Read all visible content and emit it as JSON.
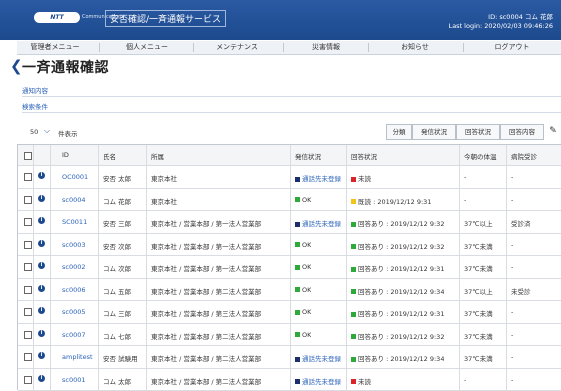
{
  "header": {
    "logo_text": "NTT",
    "logo_sub": "Communications",
    "service_title": "安否確認/一斉通報サービス",
    "user_id": "ID: sc0004 コム 花郎",
    "last_login": "Last login: 2020/02/03 09:46:26"
  },
  "nav": [
    "管理者メニュー",
    "個人メニュー",
    "メンテナンス",
    "災害情報",
    "お知らせ",
    "ログアウト"
  ],
  "page": {
    "title": "一斉通報確認",
    "link_content": "通知内容",
    "link_search": "検索条件"
  },
  "list": {
    "per_page_value": "50",
    "per_page_label": "件表示"
  },
  "toolbar": [
    "分類",
    "発信状況",
    "回答状況",
    "回答内容"
  ],
  "columns": [
    "ID",
    "氏名",
    "所属",
    "発信状況",
    "回答状況",
    "今朝の体温",
    "病院受診"
  ],
  "colors": {
    "green": "#2eaa3a",
    "red": "#d9252a",
    "yellow": "#f0c419",
    "navy": "#1a2f6b"
  },
  "rows": [
    {
      "id": "OC0001",
      "name": "安否 太郎",
      "dept": "東京本社",
      "send": "通話先未登録",
      "send_color": "navy",
      "send_link": true,
      "answer": "未読",
      "answer_color": "red",
      "temp": "-",
      "hospital": "-"
    },
    {
      "id": "sc0004",
      "name": "コム 花郎",
      "dept": "東京本社",
      "send": "OK",
      "send_color": "green",
      "send_link": false,
      "answer": "既読 : 2019/12/12 9:31",
      "answer_color": "yellow",
      "temp": "-",
      "hospital": "-"
    },
    {
      "id": "SC0011",
      "name": "安否 三郎",
      "dept": "東京本社 / 営業本部 / 第一法人営業部",
      "send": "通話先未登録",
      "send_color": "navy",
      "send_link": true,
      "answer": "回答あり : 2019/12/12 9:32",
      "answer_color": "green",
      "temp": "37℃以上",
      "hospital": "受診済"
    },
    {
      "id": "sc0003",
      "name": "安否 次郎",
      "dept": "東京本社 / 営業本部 / 第一法人営業部",
      "send": "OK",
      "send_color": "green",
      "send_link": false,
      "answer": "回答あり : 2019/12/12 9:32",
      "answer_color": "green",
      "temp": "37℃未満",
      "hospital": "-"
    },
    {
      "id": "sc0002",
      "name": "コム 次郎",
      "dept": "東京本社 / 営業本部 / 第一法人営業部",
      "send": "OK",
      "send_color": "green",
      "send_link": false,
      "answer": "回答あり : 2019/12/12 9:31",
      "answer_color": "green",
      "temp": "37℃未満",
      "hospital": "-"
    },
    {
      "id": "sc0006",
      "name": "コム 五郎",
      "dept": "東京本社 / 営業本部 / 第二法人営業部",
      "send": "OK",
      "send_color": "green",
      "send_link": false,
      "answer": "回答あり : 2019/12/12 9:34",
      "answer_color": "green",
      "temp": "37℃以上",
      "hospital": "未受診"
    },
    {
      "id": "sc0005",
      "name": "コム 三郎",
      "dept": "東京本社 / 営業本部 / 第三法人営業部",
      "send": "OK",
      "send_color": "green",
      "send_link": false,
      "answer": "回答あり : 2019/12/12 9:31",
      "answer_color": "green",
      "temp": "37℃未満",
      "hospital": "-"
    },
    {
      "id": "sc0007",
      "name": "コム 七郎",
      "dept": "東京本社 / 営業本部 / 第二法人営業部",
      "send": "OK",
      "send_color": "green",
      "send_link": false,
      "answer": "回答あり : 2019/12/12 9:32",
      "answer_color": "green",
      "temp": "37℃未満",
      "hospital": "-"
    },
    {
      "id": "amplitest",
      "name": "安否 試験用",
      "dept": "東京本社 / 営業本部 / 第二法人営業部",
      "send": "通話先未登録",
      "send_color": "navy",
      "send_link": true,
      "answer": "回答あり : 2019/12/12 9:34",
      "answer_color": "green",
      "temp": "37℃未満",
      "hospital": "-"
    },
    {
      "id": "sc0001",
      "name": "コム 太郎",
      "dept": "東京本社 / 営業本部 / 第二法人営業部",
      "send": "通話先未登録",
      "send_color": "navy",
      "send_link": true,
      "answer": "未読",
      "answer_color": "red",
      "temp": "-",
      "hospital": "-"
    }
  ]
}
